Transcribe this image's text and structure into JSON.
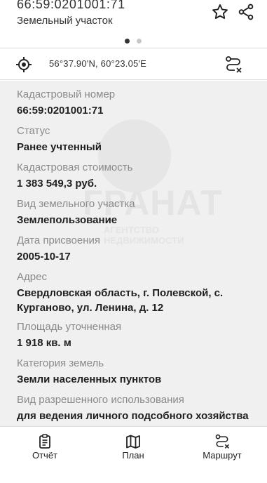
{
  "header": {
    "cadastral_id": "66:59:0201001:71",
    "subtitle": "Земельный участок",
    "favorite_icon": "star-outline-icon",
    "share_icon": "share-icon"
  },
  "carousel": {
    "pages": 2,
    "active_page": 1
  },
  "coord_bar": {
    "location_icon": "location-target-icon",
    "coordinates": "56°37.90'N, 60°23.05'E",
    "route_icon": "route-icon"
  },
  "watermark": {
    "text": "ГРАНАТ",
    "subtitle": "АГЕНТСТВО НЕДВИЖИМОСТИ"
  },
  "fields": [
    {
      "label": "Кадастровый номер",
      "value": "66:59:0201001:71"
    },
    {
      "label": "Статус",
      "value": "Ранее учтенный"
    },
    {
      "label": "Кадастровая стоимость",
      "value": "1 383 549,3 руб."
    },
    {
      "label": "Вид земельного участка",
      "value": "Землепользование"
    },
    {
      "label": "Дата присвоения",
      "value": "2005-10-17"
    },
    {
      "label": "Адрес",
      "value": "Свердловская область, г. Полевской, с. Курганово, ул. Ленина, д. 12"
    },
    {
      "label": "Площадь уточненная",
      "value": "1 918 кв. м"
    },
    {
      "label": "Категория земель",
      "value": "Земли населенных пунктов"
    },
    {
      "label": "Вид разрешенного использования",
      "value": "для ведения личного подсобного хозяйства"
    }
  ],
  "bottom_nav": {
    "report_label": "Отчёт",
    "plan_label": "План",
    "route_label": "Маршрут"
  },
  "colors": {
    "content_bg": "#f0f0f0",
    "label": "#8a8a8a",
    "value": "#1f1f1f"
  }
}
